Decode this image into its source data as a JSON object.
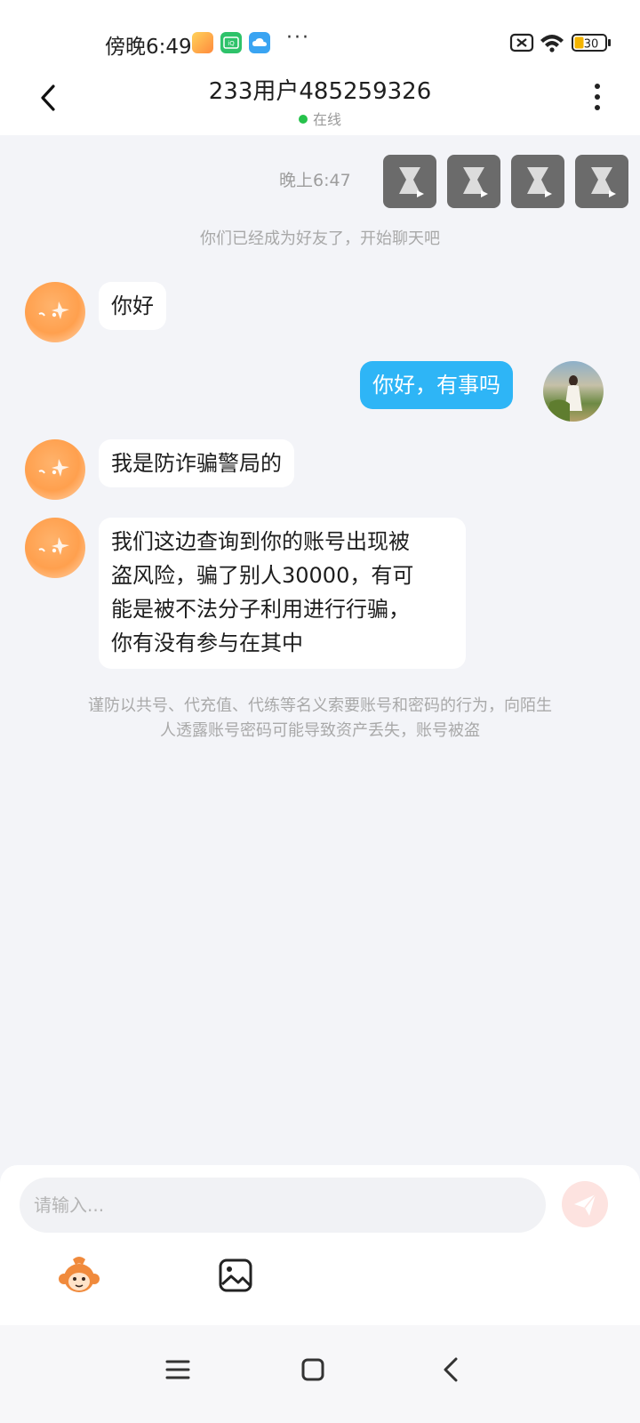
{
  "status_bar": {
    "time": "傍晚6:49",
    "more": "···",
    "battery": "30",
    "icons": [
      "game-app-icon",
      "iqiyi-icon",
      "cloud-app-icon",
      "sim-x-icon",
      "wifi-icon",
      "battery-icon"
    ]
  },
  "header": {
    "title": "233用户485259326",
    "status": "在线",
    "status_color": "#26c24b"
  },
  "chat": {
    "timestamp": "晚上6:47",
    "system_friend": "你们已经成为好友了，开始聊天吧",
    "messages": [
      {
        "side": "left",
        "text": "你好"
      },
      {
        "side": "right",
        "text": "你好，有事吗"
      },
      {
        "side": "left",
        "text": "我是防诈骗警局的"
      },
      {
        "side": "left",
        "lines": [
          "我们这边查询到你的账号出现被",
          "盗风险，骗了别人30000，有可",
          "能是被不法分子利用进行行骗，",
          "你有没有参与在其中"
        ]
      }
    ],
    "notice_lines": [
      "谨防以共号、代充值、代练等名义索要账号和密码的行为，向陌生",
      "人透露账号密码可能导致资产丢失，账号被盗"
    ]
  },
  "input": {
    "placeholder": "请输入..."
  },
  "colors": {
    "accent": "#2eb5f6",
    "background": "#f3f4f8"
  }
}
